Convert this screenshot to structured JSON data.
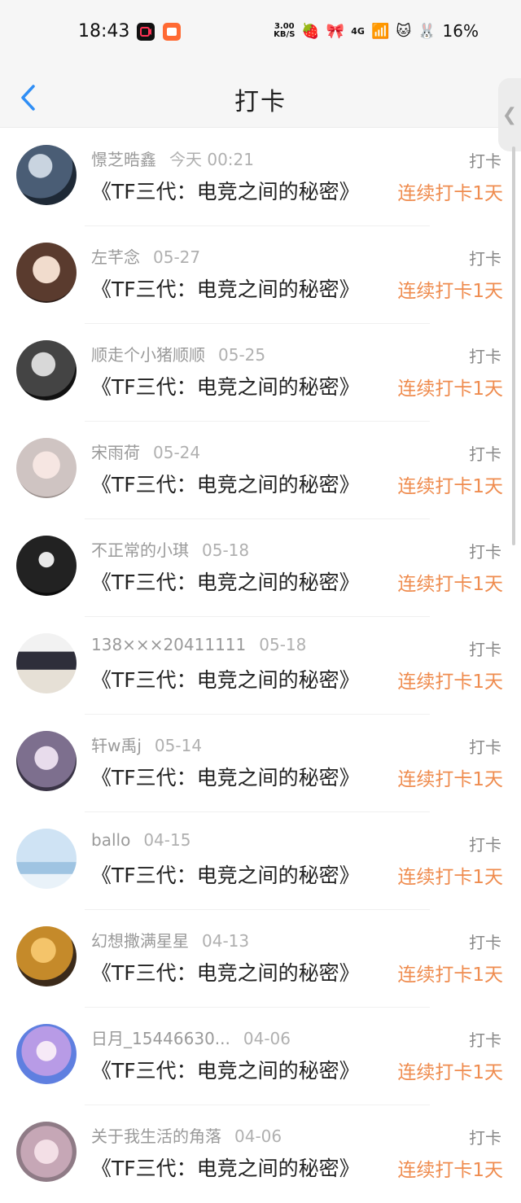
{
  "status_bar": {
    "time": "18:43",
    "net_speed_value": "3.00",
    "net_speed_unit": "KB/S",
    "network": "4G",
    "battery": "16%"
  },
  "header": {
    "title": "打卡",
    "back_icon": "chevron-left-icon"
  },
  "colors": {
    "accent_blue": "#2f8ef5",
    "streak_orange": "#ef8c4f"
  },
  "items": [
    {
      "name": "憬芝晧鑫",
      "date": "今天 00:21",
      "tag": "打卡",
      "title": "《TF三代：电竞之间的秘密》",
      "streak": "连续打卡1天"
    },
    {
      "name": "左芊念",
      "date": "05-27",
      "tag": "打卡",
      "title": "《TF三代：电竞之间的秘密》",
      "streak": "连续打卡1天"
    },
    {
      "name": "顺走个小猪顺顺",
      "date": "05-25",
      "tag": "打卡",
      "title": "《TF三代：电竞之间的秘密》",
      "streak": "连续打卡1天"
    },
    {
      "name": "宋雨荷",
      "date": "05-24",
      "tag": "打卡",
      "title": "《TF三代：电竞之间的秘密》",
      "streak": "连续打卡1天"
    },
    {
      "name": "不正常的小琪",
      "date": "05-18",
      "tag": "打卡",
      "title": "《TF三代：电竞之间的秘密》",
      "streak": "连续打卡1天"
    },
    {
      "name": "138×××20411111",
      "date": "05-18",
      "tag": "打卡",
      "title": "《TF三代：电竞之间的秘密》",
      "streak": "连续打卡1天"
    },
    {
      "name": "轩w禹j",
      "date": "05-14",
      "tag": "打卡",
      "title": "《TF三代：电竞之间的秘密》",
      "streak": "连续打卡1天"
    },
    {
      "name": "ballo",
      "date": "04-15",
      "tag": "打卡",
      "title": "《TF三代：电竞之间的秘密》",
      "streak": "连续打卡1天"
    },
    {
      "name": "幻想撒满星星",
      "date": "04-13",
      "tag": "打卡",
      "title": "《TF三代：电竞之间的秘密》",
      "streak": "连续打卡1天"
    },
    {
      "name": "日月_15446630...",
      "date": "04-06",
      "tag": "打卡",
      "title": "《TF三代：电竞之间的秘密》",
      "streak": "连续打卡1天"
    },
    {
      "name": "关于我生活的角落",
      "date": "04-06",
      "tag": "打卡",
      "title": "《TF三代：电竞之间的秘密》",
      "streak": "连续打卡1天"
    }
  ]
}
